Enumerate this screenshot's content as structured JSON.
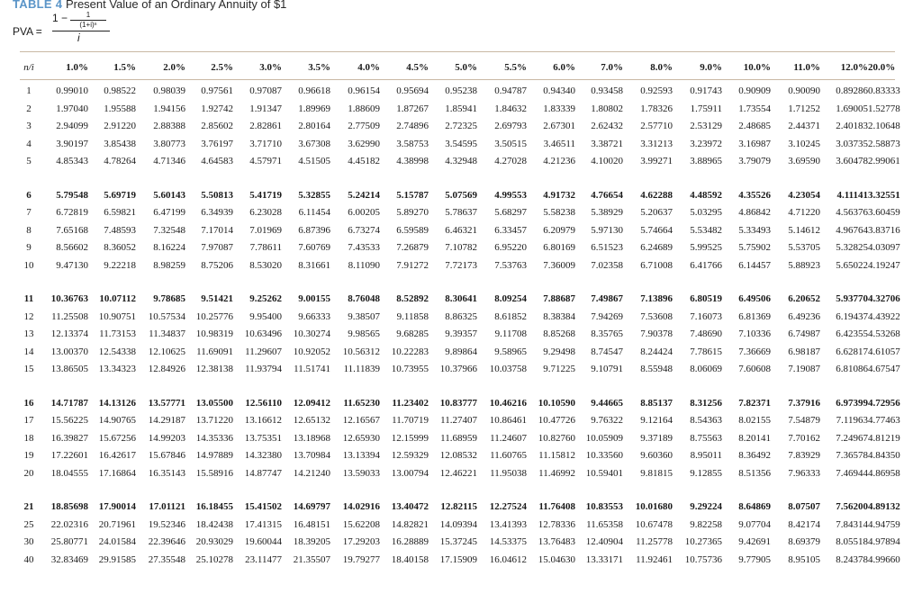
{
  "table": {
    "label": "TABLE 4",
    "title": "Present Value of an Ordinary Annuity of $1"
  },
  "formula": {
    "lhs": "PVA =",
    "one_minus": "1 −",
    "inner_num": "1",
    "inner_den": "(1+i)ⁿ",
    "denominator": "i"
  },
  "header": {
    "n": "n/i",
    "rates": [
      "1.0%",
      "1.5%",
      "2.0%",
      "2.5%",
      "3.0%",
      "3.5%",
      "4.0%",
      "4.5%",
      "5.0%",
      "5.5%",
      "6.0%",
      "7.0%",
      "8.0%",
      "9.0%",
      "10.0%",
      "11.0%",
      "12.0%",
      "20.0%"
    ]
  },
  "rows": [
    {
      "n": "1",
      "bold": false,
      "values": [
        "0.99010",
        "0.98522",
        "0.98039",
        "0.97561",
        "0.97087",
        "0.96618",
        "0.96154",
        "0.95694",
        "0.95238",
        "0.94787",
        "0.94340",
        "0.93458",
        "0.92593",
        "0.91743",
        "0.90909",
        "0.90090",
        "0.89286",
        "0.83333"
      ]
    },
    {
      "n": "2",
      "bold": false,
      "values": [
        "1.97040",
        "1.95588",
        "1.94156",
        "1.92742",
        "1.91347",
        "1.89969",
        "1.88609",
        "1.87267",
        "1.85941",
        "1.84632",
        "1.83339",
        "1.80802",
        "1.78326",
        "1.75911",
        "1.73554",
        "1.71252",
        "1.69005",
        "1.52778"
      ]
    },
    {
      "n": "3",
      "bold": false,
      "values": [
        "2.94099",
        "2.91220",
        "2.88388",
        "2.85602",
        "2.82861",
        "2.80164",
        "2.77509",
        "2.74896",
        "2.72325",
        "2.69793",
        "2.67301",
        "2.62432",
        "2.57710",
        "2.53129",
        "2.48685",
        "2.44371",
        "2.40183",
        "2.10648"
      ]
    },
    {
      "n": "4",
      "bold": false,
      "values": [
        "3.90197",
        "3.85438",
        "3.80773",
        "3.76197",
        "3.71710",
        "3.67308",
        "3.62990",
        "3.58753",
        "3.54595",
        "3.50515",
        "3.46511",
        "3.38721",
        "3.31213",
        "3.23972",
        "3.16987",
        "3.10245",
        "3.03735",
        "2.58873"
      ]
    },
    {
      "n": "5",
      "bold": false,
      "values": [
        "4.85343",
        "4.78264",
        "4.71346",
        "4.64583",
        "4.57971",
        "4.51505",
        "4.45182",
        "4.38998",
        "4.32948",
        "4.27028",
        "4.21236",
        "4.10020",
        "3.99271",
        "3.88965",
        "3.79079",
        "3.69590",
        "3.60478",
        "2.99061"
      ]
    },
    {
      "n": "6",
      "bold": true,
      "values": [
        "5.79548",
        "5.69719",
        "5.60143",
        "5.50813",
        "5.41719",
        "5.32855",
        "5.24214",
        "5.15787",
        "5.07569",
        "4.99553",
        "4.91732",
        "4.76654",
        "4.62288",
        "4.48592",
        "4.35526",
        "4.23054",
        "4.11141",
        "3.32551"
      ]
    },
    {
      "n": "7",
      "bold": false,
      "values": [
        "6.72819",
        "6.59821",
        "6.47199",
        "6.34939",
        "6.23028",
        "6.11454",
        "6.00205",
        "5.89270",
        "5.78637",
        "5.68297",
        "5.58238",
        "5.38929",
        "5.20637",
        "5.03295",
        "4.86842",
        "4.71220",
        "4.56376",
        "3.60459"
      ]
    },
    {
      "n": "8",
      "bold": false,
      "values": [
        "7.65168",
        "7.48593",
        "7.32548",
        "7.17014",
        "7.01969",
        "6.87396",
        "6.73274",
        "6.59589",
        "6.46321",
        "6.33457",
        "6.20979",
        "5.97130",
        "5.74664",
        "5.53482",
        "5.33493",
        "5.14612",
        "4.96764",
        "3.83716"
      ]
    },
    {
      "n": "9",
      "bold": false,
      "values": [
        "8.56602",
        "8.36052",
        "8.16224",
        "7.97087",
        "7.78611",
        "7.60769",
        "7.43533",
        "7.26879",
        "7.10782",
        "6.95220",
        "6.80169",
        "6.51523",
        "6.24689",
        "5.99525",
        "5.75902",
        "5.53705",
        "5.32825",
        "4.03097"
      ]
    },
    {
      "n": "10",
      "bold": false,
      "values": [
        "9.47130",
        "9.22218",
        "8.98259",
        "8.75206",
        "8.53020",
        "8.31661",
        "8.11090",
        "7.91272",
        "7.72173",
        "7.53763",
        "7.36009",
        "7.02358",
        "6.71008",
        "6.41766",
        "6.14457",
        "5.88923",
        "5.65022",
        "4.19247"
      ]
    },
    {
      "n": "11",
      "bold": true,
      "values": [
        "10.36763",
        "10.07112",
        "9.78685",
        "9.51421",
        "9.25262",
        "9.00155",
        "8.76048",
        "8.52892",
        "8.30641",
        "8.09254",
        "7.88687",
        "7.49867",
        "7.13896",
        "6.80519",
        "6.49506",
        "6.20652",
        "5.93770",
        "4.32706"
      ]
    },
    {
      "n": "12",
      "bold": false,
      "values": [
        "11.25508",
        "10.90751",
        "10.57534",
        "10.25776",
        "9.95400",
        "9.66333",
        "9.38507",
        "9.11858",
        "8.86325",
        "8.61852",
        "8.38384",
        "7.94269",
        "7.53608",
        "7.16073",
        "6.81369",
        "6.49236",
        "6.19437",
        "4.43922"
      ]
    },
    {
      "n": "13",
      "bold": false,
      "values": [
        "12.13374",
        "11.73153",
        "11.34837",
        "10.98319",
        "10.63496",
        "10.30274",
        "9.98565",
        "9.68285",
        "9.39357",
        "9.11708",
        "8.85268",
        "8.35765",
        "7.90378",
        "7.48690",
        "7.10336",
        "6.74987",
        "6.42355",
        "4.53268"
      ]
    },
    {
      "n": "14",
      "bold": false,
      "values": [
        "13.00370",
        "12.54338",
        "12.10625",
        "11.69091",
        "11.29607",
        "10.92052",
        "10.56312",
        "10.22283",
        "9.89864",
        "9.58965",
        "9.29498",
        "8.74547",
        "8.24424",
        "7.78615",
        "7.36669",
        "6.98187",
        "6.62817",
        "4.61057"
      ]
    },
    {
      "n": "15",
      "bold": false,
      "values": [
        "13.86505",
        "13.34323",
        "12.84926",
        "12.38138",
        "11.93794",
        "11.51741",
        "11.11839",
        "10.73955",
        "10.37966",
        "10.03758",
        "9.71225",
        "9.10791",
        "8.55948",
        "8.06069",
        "7.60608",
        "7.19087",
        "6.81086",
        "4.67547"
      ]
    },
    {
      "n": "16",
      "bold": true,
      "values": [
        "14.71787",
        "14.13126",
        "13.57771",
        "13.05500",
        "12.56110",
        "12.09412",
        "11.65230",
        "11.23402",
        "10.83777",
        "10.46216",
        "10.10590",
        "9.44665",
        "8.85137",
        "8.31256",
        "7.82371",
        "7.37916",
        "6.97399",
        "4.72956"
      ]
    },
    {
      "n": "17",
      "bold": false,
      "values": [
        "15.56225",
        "14.90765",
        "14.29187",
        "13.71220",
        "13.16612",
        "12.65132",
        "12.16567",
        "11.70719",
        "11.27407",
        "10.86461",
        "10.47726",
        "9.76322",
        "9.12164",
        "8.54363",
        "8.02155",
        "7.54879",
        "7.11963",
        "4.77463"
      ]
    },
    {
      "n": "18",
      "bold": false,
      "values": [
        "16.39827",
        "15.67256",
        "14.99203",
        "14.35336",
        "13.75351",
        "13.18968",
        "12.65930",
        "12.15999",
        "11.68959",
        "11.24607",
        "10.82760",
        "10.05909",
        "9.37189",
        "8.75563",
        "8.20141",
        "7.70162",
        "7.24967",
        "4.81219"
      ]
    },
    {
      "n": "19",
      "bold": false,
      "values": [
        "17.22601",
        "16.42617",
        "15.67846",
        "14.97889",
        "14.32380",
        "13.70984",
        "13.13394",
        "12.59329",
        "12.08532",
        "11.60765",
        "11.15812",
        "10.33560",
        "9.60360",
        "8.95011",
        "8.36492",
        "7.83929",
        "7.36578",
        "4.84350"
      ]
    },
    {
      "n": "20",
      "bold": false,
      "values": [
        "18.04555",
        "17.16864",
        "16.35143",
        "15.58916",
        "14.87747",
        "14.21240",
        "13.59033",
        "13.00794",
        "12.46221",
        "11.95038",
        "11.46992",
        "10.59401",
        "9.81815",
        "9.12855",
        "8.51356",
        "7.96333",
        "7.46944",
        "4.86958"
      ]
    },
    {
      "n": "21",
      "bold": true,
      "values": [
        "18.85698",
        "17.90014",
        "17.01121",
        "16.18455",
        "15.41502",
        "14.69797",
        "14.02916",
        "13.40472",
        "12.82115",
        "12.27524",
        "11.76408",
        "10.83553",
        "10.01680",
        "9.29224",
        "8.64869",
        "8.07507",
        "7.56200",
        "4.89132"
      ]
    },
    {
      "n": "25",
      "bold": false,
      "values": [
        "22.02316",
        "20.71961",
        "19.52346",
        "18.42438",
        "17.41315",
        "16.48151",
        "15.62208",
        "14.82821",
        "14.09394",
        "13.41393",
        "12.78336",
        "11.65358",
        "10.67478",
        "9.82258",
        "9.07704",
        "8.42174",
        "7.84314",
        "4.94759"
      ]
    },
    {
      "n": "30",
      "bold": false,
      "values": [
        "25.80771",
        "24.01584",
        "22.39646",
        "20.93029",
        "19.60044",
        "18.39205",
        "17.29203",
        "16.28889",
        "15.37245",
        "14.53375",
        "13.76483",
        "12.40904",
        "11.25778",
        "10.27365",
        "9.42691",
        "8.69379",
        "8.05518",
        "4.97894"
      ]
    },
    {
      "n": "40",
      "bold": false,
      "values": [
        "32.83469",
        "29.91585",
        "27.35548",
        "25.10278",
        "23.11477",
        "21.35507",
        "19.79277",
        "18.40158",
        "17.15909",
        "16.04612",
        "15.04630",
        "13.33171",
        "11.92461",
        "10.75736",
        "9.77905",
        "8.95105",
        "8.24378",
        "4.99660"
      ]
    }
  ]
}
